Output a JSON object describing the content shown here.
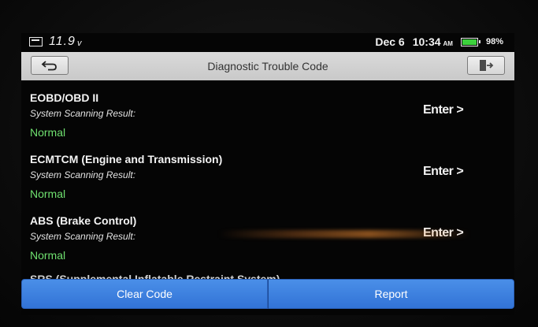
{
  "status": {
    "voltage": "11.9",
    "voltage_unit": "v",
    "date": "Dec 6",
    "time": "10:34",
    "ampm": "AM",
    "battery_pct": "98%",
    "battery_level": 0.98,
    "battery_color": "#3cd13c"
  },
  "header": {
    "title": "Diagnostic Trouble Code",
    "back_icon": "back-arrow-icon",
    "exit_icon": "exit-door-icon"
  },
  "systems": [
    {
      "name": "EOBD/OBD II",
      "scan_label": "System Scanning Result:",
      "result": "Normal",
      "action": "Enter >"
    },
    {
      "name": "ECMTCM (Engine and Transmission)",
      "scan_label": "System Scanning Result:",
      "result": "Normal",
      "action": "Enter >"
    },
    {
      "name": "ABS (Brake Control)",
      "scan_label": "System Scanning Result:",
      "result": "Normal",
      "action": "Enter >"
    }
  ],
  "partial_row": "SRS (Supplemental Inflatable Restraint System)",
  "footer": {
    "clear_label": "Clear Code",
    "report_label": "Report",
    "button_color": "#3f84e2"
  },
  "colors": {
    "result_normal": "#6fe06f",
    "title_bar": "#d2d2d2"
  }
}
